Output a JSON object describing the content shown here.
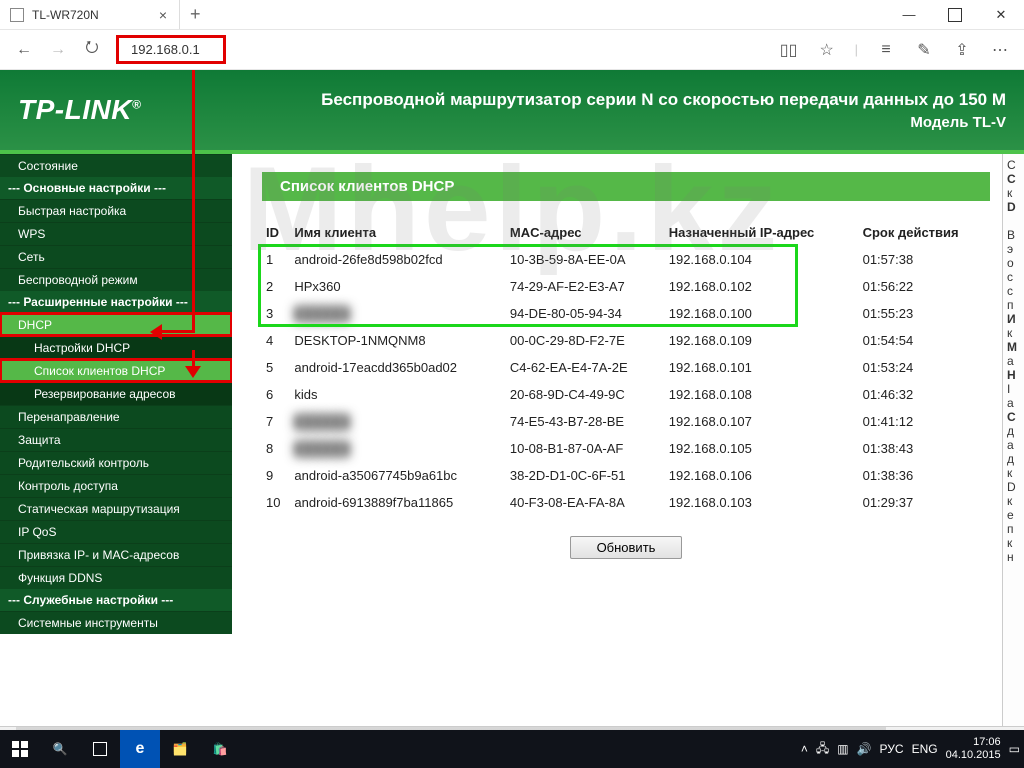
{
  "browser": {
    "tab_title": "TL-WR720N",
    "url": "192.168.0.1"
  },
  "header": {
    "logo": "TP-LINK",
    "title_line1": "Беспроводной маршрутизатор серии N со скоростью передачи данных до 150 M",
    "title_line2": "Модель TL-V"
  },
  "sidebar": {
    "status": "Состояние",
    "group_basic": "--- Основные настройки ---",
    "quick_setup": "Быстрая настройка",
    "wps": "WPS",
    "network": "Сеть",
    "wireless": "Беспроводной режим",
    "group_ext": "--- Расширенные настройки ---",
    "dhcp": "DHCP",
    "dhcp_settings": "Настройки DHCP",
    "dhcp_clients": "Список клиентов DHCP",
    "dhcp_reserve": "Резервирование адресов",
    "forwarding": "Перенаправление",
    "security": "Защита",
    "parental": "Родительский контроль",
    "access": "Контроль доступа",
    "static_route": "Статическая маршрутизация",
    "ipqos": "IP QoS",
    "ipmac": "Привязка IP- и MAC-адресов",
    "ddns": "Функция DDNS",
    "group_service": "--- Служебные настройки ---",
    "tools": "Системные инструменты"
  },
  "section_title": "Список клиентов DHCP",
  "table": {
    "headers": {
      "id": "ID",
      "name": "Имя клиента",
      "mac": "MAC-адрес",
      "ip": "Назначенный IP-адрес",
      "lease": "Срок действия"
    },
    "rows": [
      {
        "id": "1",
        "name": "android-26fe8d598b02fcd",
        "mac": "10-3B-59-8A-EE-0A",
        "ip": "192.168.0.104",
        "lease": "01:57:38",
        "hl": true
      },
      {
        "id": "2",
        "name": "HPx360",
        "mac": "74-29-AF-E2-E3-A7",
        "ip": "192.168.0.102",
        "lease": "01:56:22",
        "hl": true
      },
      {
        "id": "3",
        "name": "hidden",
        "mac": "94-DE-80-05-94-34",
        "ip": "192.168.0.100",
        "lease": "01:55:23",
        "hl": true,
        "blur": true
      },
      {
        "id": "4",
        "name": "DESKTOP-1NMQNM8",
        "mac": "00-0C-29-8D-F2-7E",
        "ip": "192.168.0.109",
        "lease": "01:54:54"
      },
      {
        "id": "5",
        "name": "android-17eacdd365b0ad02",
        "mac": "C4-62-EA-E4-7A-2E",
        "ip": "192.168.0.101",
        "lease": "01:53:24"
      },
      {
        "id": "6",
        "name": "kids",
        "mac": "20-68-9D-C4-49-9C",
        "ip": "192.168.0.108",
        "lease": "01:46:32"
      },
      {
        "id": "7",
        "name": "hidden",
        "mac": "74-E5-43-B7-28-BE",
        "ip": "192.168.0.107",
        "lease": "01:41:12",
        "blur": true
      },
      {
        "id": "8",
        "name": "hidden",
        "mac": "10-08-B1-87-0A-AF",
        "ip": "192.168.0.105",
        "lease": "01:38:43",
        "blur": true
      },
      {
        "id": "9",
        "name": "android-a35067745b9a61bc",
        "mac": "38-2D-D1-0C-6F-51",
        "ip": "192.168.0.106",
        "lease": "01:38:36"
      },
      {
        "id": "10",
        "name": "android-6913889f7ba11865",
        "mac": "40-F3-08-EA-FA-8A",
        "ip": "192.168.0.103",
        "lease": "01:29:37"
      }
    ]
  },
  "refresh_label": "Обновить",
  "watermark": "Mhelp.kz",
  "taskbar": {
    "lang": "РУС",
    "kbd": "ENG",
    "time": "17:06",
    "date": "04.10.2015"
  }
}
